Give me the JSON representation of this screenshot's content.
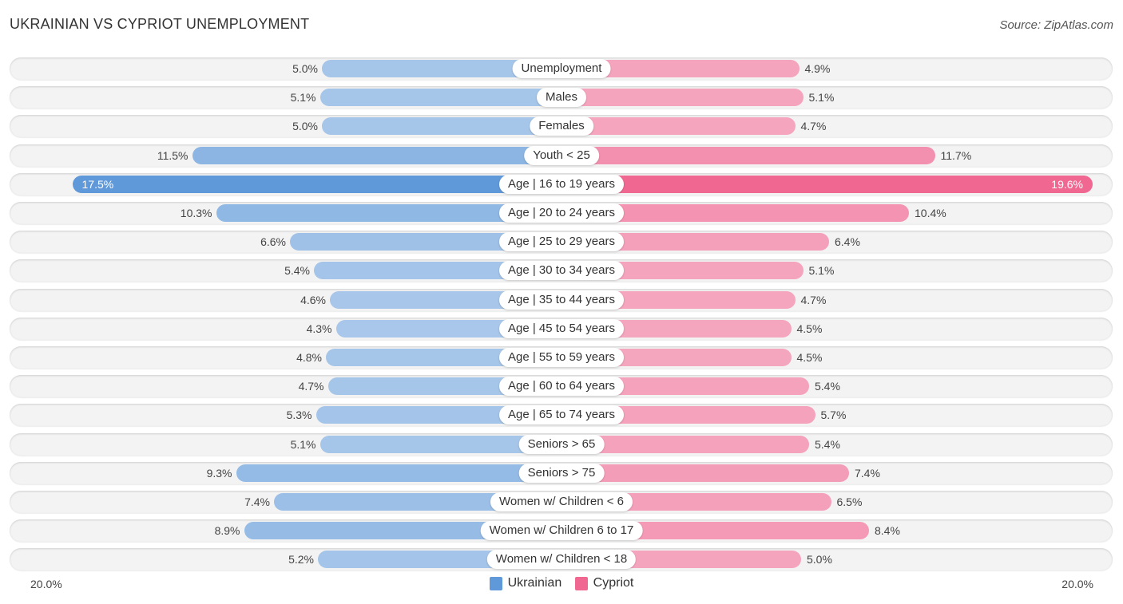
{
  "header": {
    "title": "UKRAINIAN VS CYPRIOT UNEMPLOYMENT",
    "source": "Source: ZipAtlas.com"
  },
  "colors": {
    "ukrainian_light": "#a9c8ea",
    "ukrainian_strong": "#6099d9",
    "cypriot_light": "#f5a7c0",
    "cypriot_strong": "#f06892"
  },
  "chart_data": {
    "type": "bar",
    "orientation": "horizontal-diverging",
    "title": "UKRAINIAN VS CYPRIOT UNEMPLOYMENT",
    "categories": [
      "Unemployment",
      "Males",
      "Females",
      "Youth < 25",
      "Age | 16 to 19 years",
      "Age | 20 to 24 years",
      "Age | 25 to 29 years",
      "Age | 30 to 34 years",
      "Age | 35 to 44 years",
      "Age | 45 to 54 years",
      "Age | 55 to 59 years",
      "Age | 60 to 64 years",
      "Age | 65 to 74 years",
      "Seniors > 65",
      "Seniors > 75",
      "Women w/ Children < 6",
      "Women w/ Children 6 to 17",
      "Women w/ Children < 18"
    ],
    "series": [
      {
        "name": "Ukrainian",
        "side": "left",
        "values": [
          5.0,
          5.1,
          5.0,
          11.5,
          17.5,
          10.3,
          6.6,
          5.4,
          4.6,
          4.3,
          4.8,
          4.7,
          5.3,
          5.1,
          9.3,
          7.4,
          8.9,
          5.2
        ],
        "labels": [
          "5.0%",
          "5.1%",
          "5.0%",
          "11.5%",
          "17.5%",
          "10.3%",
          "6.6%",
          "5.4%",
          "4.6%",
          "4.3%",
          "4.8%",
          "4.7%",
          "5.3%",
          "5.1%",
          "9.3%",
          "7.4%",
          "8.9%",
          "5.2%"
        ]
      },
      {
        "name": "Cypriot",
        "side": "right",
        "values": [
          4.9,
          5.1,
          4.7,
          11.7,
          19.6,
          10.4,
          6.4,
          5.1,
          4.7,
          4.5,
          4.5,
          5.4,
          5.7,
          5.4,
          7.4,
          6.5,
          8.4,
          5.0
        ],
        "labels": [
          "4.9%",
          "5.1%",
          "4.7%",
          "11.7%",
          "19.6%",
          "10.4%",
          "6.4%",
          "5.1%",
          "4.7%",
          "4.5%",
          "4.5%",
          "5.4%",
          "5.7%",
          "5.4%",
          "7.4%",
          "6.5%",
          "8.4%",
          "5.0%"
        ]
      }
    ],
    "axis": {
      "left_max_label": "20.0%",
      "right_max_label": "20.0%",
      "max": 20.0,
      "unit": "%"
    },
    "legend": {
      "position": "bottom-center",
      "items": [
        "Ukrainian",
        "Cypriot"
      ]
    },
    "highlighted_category": "Age | 16 to 19 years"
  }
}
